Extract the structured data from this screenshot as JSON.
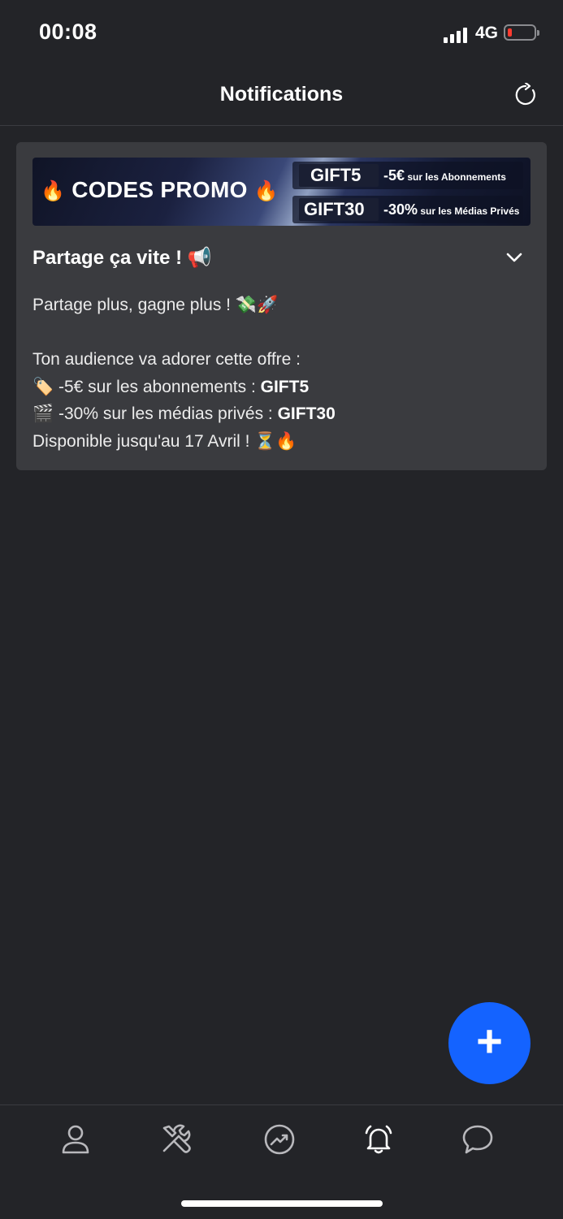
{
  "status": {
    "time": "00:08",
    "network": "4G",
    "battery_level": 0.15
  },
  "header": {
    "title": "Notifications"
  },
  "banner": {
    "title": "CODES PROMO",
    "codes": [
      {
        "code": "GIFT5",
        "discount": "-5€",
        "target": "sur les Abonnements"
      },
      {
        "code": "GIFT30",
        "discount": "-30%",
        "target": "sur les Médias Privés"
      }
    ]
  },
  "notification": {
    "title": "Partage ça vite ! 📢",
    "line1": "Partage plus, gagne plus ! 💸🚀",
    "line2": "Ton audience va adorer cette offre :",
    "line3_prefix": "🏷️ -5€ sur les abonnements : ",
    "line3_code": "GIFT5",
    "line4_prefix": "🎬 -30% sur les médias privés : ",
    "line4_code": "GIFT30",
    "line5": "Disponible jusqu'au 17 Avril ! ⏳🔥"
  },
  "fab": {
    "label": "+"
  },
  "tabs": [
    {
      "icon": "profile-icon"
    },
    {
      "icon": "tools-icon"
    },
    {
      "icon": "stats-icon"
    },
    {
      "icon": "bell-icon",
      "active": true
    },
    {
      "icon": "chat-icon"
    }
  ],
  "colors": {
    "accent": "#1463ff",
    "background": "#232428",
    "card": "#3a3b3f"
  }
}
